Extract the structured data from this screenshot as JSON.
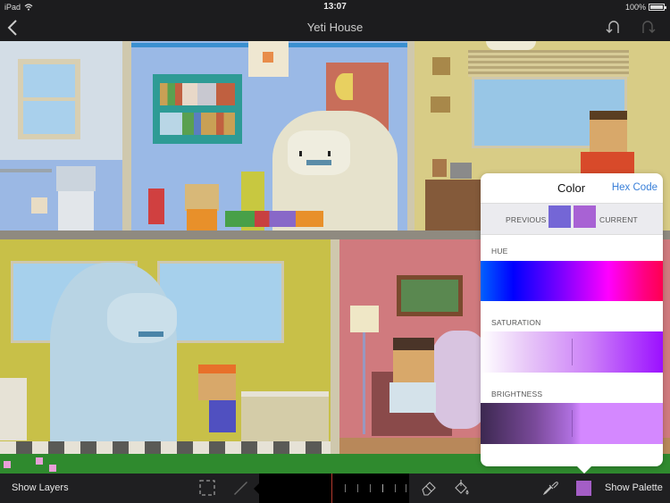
{
  "status_bar": {
    "device": "iPad",
    "time": "13:07",
    "battery": "100%"
  },
  "nav": {
    "title": "Yeti House",
    "back_icon": "chevron-left-icon",
    "undo_icon": "undo-icon",
    "redo_icon": "redo-icon"
  },
  "canvas": {
    "description": "Pixel art of a house cross-section with yetis and people",
    "rooms": [
      "bathroom",
      "kids-room",
      "bedroom",
      "kitchen",
      "living-room"
    ]
  },
  "color_popover": {
    "title": "Color",
    "hex_code_label": "Hex Code",
    "previous_label": "PREVIOUS",
    "current_label": "CURRENT",
    "previous_color": "#7466d6",
    "current_color": "#a862d4",
    "hue_label": "HUE",
    "saturation_label": "SATURATION",
    "brightness_label": "BRIGHTNESS",
    "hue_value": 0.78,
    "saturation_value": 0.5,
    "brightness_value": 0.5
  },
  "toolbar": {
    "show_layers": "Show Layers",
    "show_palette": "Show Palette",
    "selection_icon": "selection-icon",
    "pencil_icon": "pencil-icon",
    "eraser_icon": "eraser-icon",
    "fill_icon": "paint-bucket-icon",
    "eyedropper_icon": "eyedropper-icon",
    "current_color": "#a45ec6"
  },
  "colors": {
    "accent": "#3a80d9",
    "chrome": "#1c1c1e",
    "grass": "#2f8a2e"
  }
}
